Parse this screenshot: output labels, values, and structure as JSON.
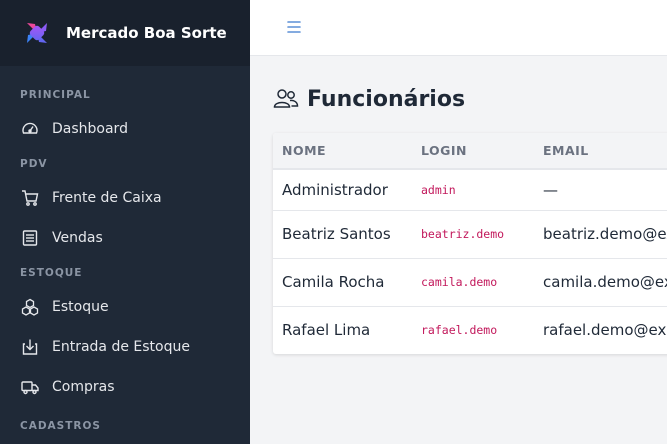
{
  "app": {
    "name": "Mercado Boa Sorte"
  },
  "colors": {
    "sidebar_bg": "#1f2937",
    "accent": "#6366f1",
    "login_code": "#c2185b"
  },
  "sidebar": {
    "sections": [
      {
        "title": "PRINCIPAL",
        "items": [
          {
            "label": "Dashboard",
            "icon": "gauge-icon"
          }
        ]
      },
      {
        "title": "PDV",
        "items": [
          {
            "label": "Frente de Caixa",
            "icon": "cart-icon"
          },
          {
            "label": "Vendas",
            "icon": "receipt-icon"
          }
        ]
      },
      {
        "title": "ESTOQUE",
        "items": [
          {
            "label": "Estoque",
            "icon": "boxes-icon"
          },
          {
            "label": "Entrada de Estoque",
            "icon": "box-arrow-in-icon"
          },
          {
            "label": "Compras",
            "icon": "truck-icon"
          }
        ]
      },
      {
        "title": "CADASTROS",
        "items": []
      }
    ]
  },
  "page": {
    "title": "Funcionários",
    "title_icon": "people-icon"
  },
  "table": {
    "headers": [
      "NOME",
      "LOGIN",
      "EMAIL"
    ],
    "rows": [
      {
        "name": "Administrador",
        "login": "admin",
        "email": "—"
      },
      {
        "name": "Beatriz Santos",
        "login": "beatriz.demo",
        "email": "beatriz.demo@example.com"
      },
      {
        "name": "Camila Rocha",
        "login": "camila.demo",
        "email": "camila.demo@example.com"
      },
      {
        "name": "Rafael Lima",
        "login": "rafael.demo",
        "email": "rafael.demo@example.com"
      }
    ]
  }
}
